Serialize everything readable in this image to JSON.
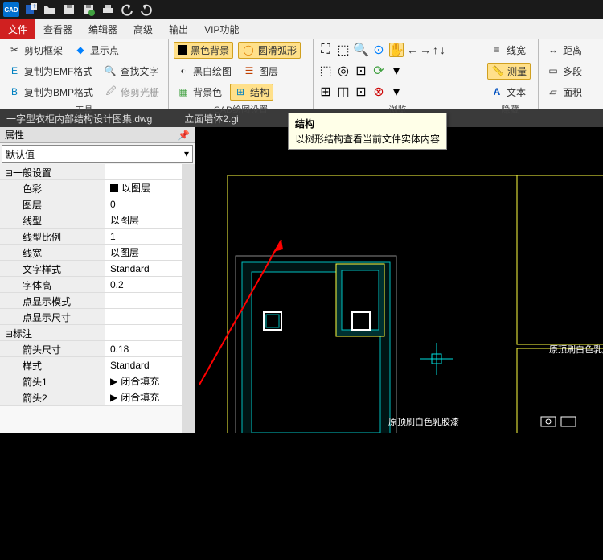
{
  "app": {
    "logo": "CAD"
  },
  "menu": {
    "items": [
      "文件",
      "查看器",
      "编辑器",
      "高级",
      "输出",
      "VIP功能"
    ],
    "active_index": 0
  },
  "ribbon": {
    "groups": [
      {
        "label": "工具",
        "rows": [
          [
            {
              "icon": "✂",
              "text": "剪切框架"
            },
            {
              "icon": "◆",
              "text": "显示点"
            }
          ],
          [
            {
              "icon": "📄",
              "text": "复制为EMF格式"
            },
            {
              "icon": "🔍",
              "text": "查找文字"
            }
          ],
          [
            {
              "icon": "📄",
              "text": "复制为BMP格式"
            },
            {
              "icon": "🖉",
              "text": "修剪光栅"
            }
          ]
        ]
      },
      {
        "label": "CAD绘图设置",
        "rows": [
          [
            {
              "icon": "■",
              "text": "黑色背景",
              "hi": true
            },
            {
              "icon": "◯",
              "text": "圆滑弧形",
              "hi": true
            }
          ],
          [
            {
              "icon": "□",
              "text": "黑白绘图"
            },
            {
              "icon": "☰",
              "text": "图层"
            }
          ],
          [
            {
              "icon": "▦",
              "text": "背景色"
            },
            {
              "icon": "⊞",
              "text": "结构",
              "hi": true
            }
          ]
        ]
      },
      {
        "label": "浏览",
        "tool_icons": true
      },
      {
        "label": "隐藏",
        "rows": [
          [
            {
              "icon": "≡",
              "text": "线宽"
            }
          ],
          [
            {
              "icon": "📏",
              "text": "测量",
              "hi": true
            }
          ],
          [
            {
              "icon": "A",
              "text": "文本"
            }
          ]
        ]
      },
      {
        "label": "",
        "rows": [
          [
            {
              "icon": "↔",
              "text": "距离"
            }
          ],
          [
            {
              "icon": "▭",
              "text": "多段"
            }
          ],
          [
            {
              "icon": "▱",
              "text": "面积"
            }
          ]
        ]
      }
    ]
  },
  "tabs": {
    "items": [
      "一字型衣柜内部结构设计图集.dwg",
      "立面墙体2.gi"
    ]
  },
  "tooltip": {
    "title": "结构",
    "body": "以树形结构查看当前文件实体内容"
  },
  "props": {
    "title": "属性",
    "combo": "默认值",
    "categories": [
      {
        "name": "一般设置",
        "rows": [
          {
            "k": "色彩",
            "v": "以图层",
            "swatch": true
          },
          {
            "k": "图层",
            "v": "0"
          },
          {
            "k": "线型",
            "v": "以图层"
          },
          {
            "k": "线型比例",
            "v": "1"
          },
          {
            "k": "线宽",
            "v": "以图层"
          },
          {
            "k": "文字样式",
            "v": "Standard"
          },
          {
            "k": "字体高",
            "v": "0.2"
          },
          {
            "k": "点显示模式",
            "v": ""
          },
          {
            "k": "点显示尺寸",
            "v": ""
          }
        ]
      },
      {
        "name": "标注",
        "rows": [
          {
            "k": "箭头尺寸",
            "v": "0.18"
          },
          {
            "k": "样式",
            "v": "Standard"
          },
          {
            "k": "箭头1",
            "v": "闭合填充",
            "arrow": true
          },
          {
            "k": "箭头2",
            "v": "闭合填充",
            "arrow": true
          }
        ]
      }
    ]
  },
  "canvas": {
    "annotations": [
      "原顶刷白色乳胶",
      "原顶刷白色乳胶漆"
    ]
  }
}
